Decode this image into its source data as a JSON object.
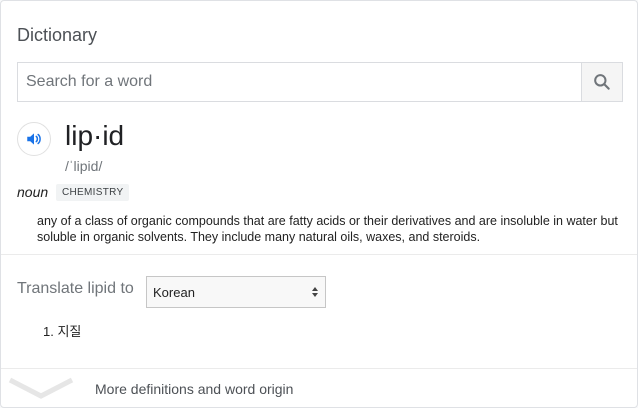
{
  "widget": {
    "title": "Dictionary"
  },
  "search": {
    "placeholder": "Search for a word",
    "value": "",
    "button_icon": "search-icon"
  },
  "entry": {
    "speaker_icon": "speaker-icon",
    "headword": "lip·id",
    "phonetic": "/ˈlipid/",
    "part_of_speech": "noun",
    "domain_label": "CHEMISTRY",
    "definition": "any of a class of organic compounds that are fatty acids or their derivatives and are insoluble in water but soluble in organic solvents. They include many natural oils, waxes, and steroids."
  },
  "translate": {
    "label": "Translate lipid to",
    "selected_language": "Korean",
    "dropdown_icon": "updown-arrows-icon",
    "results": [
      {
        "number": "1.",
        "text": "지질"
      }
    ]
  },
  "more": {
    "icon": "chevron-down-icon",
    "label": "More definitions and word origin"
  },
  "colors": {
    "accent": "#1a73e8",
    "text": "#222222",
    "muted": "#70757a",
    "border": "#dadce0"
  }
}
